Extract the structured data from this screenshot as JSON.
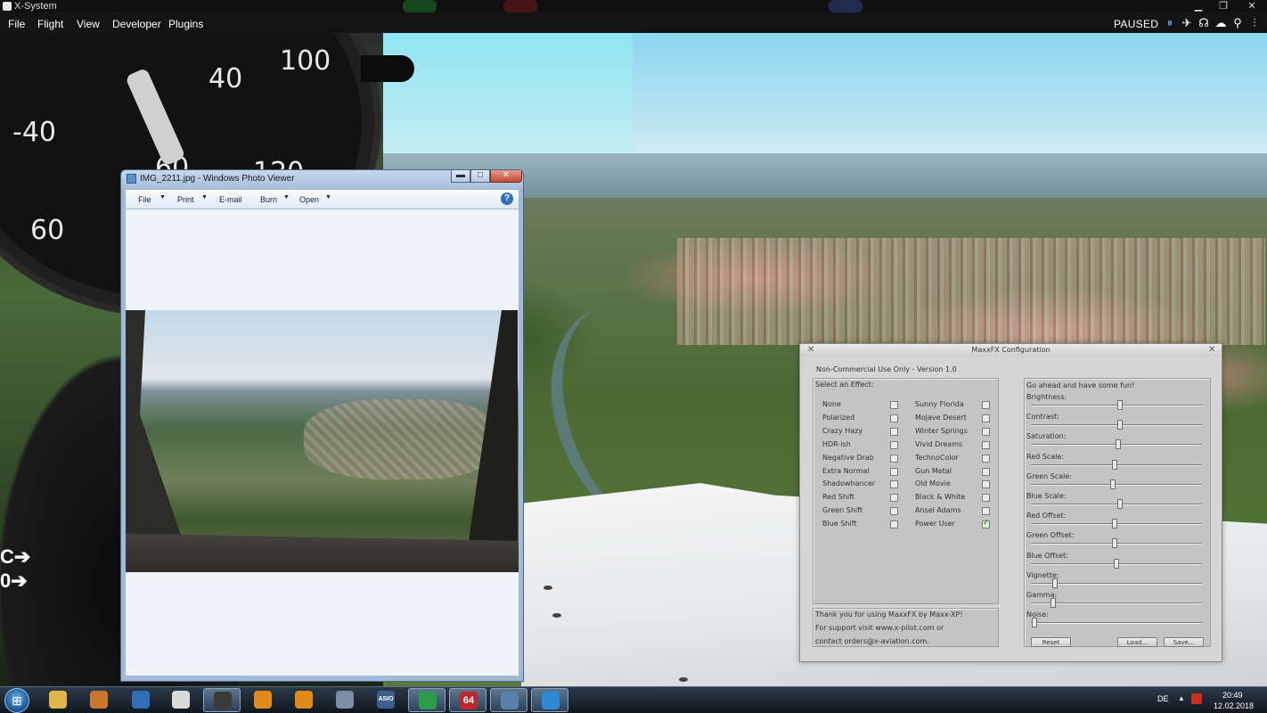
{
  "xsystem": {
    "title": "X-System",
    "menu": [
      "File",
      "Flight",
      "View",
      "Developer",
      "Plugins"
    ],
    "status": "PAUSED",
    "toolbar_icons": [
      "pause-icon",
      "airplane-icon",
      "headset-icon",
      "weather-icon",
      "map-pin-icon",
      "sliders-icon",
      "help-icon"
    ]
  },
  "cockpit_gauge": {
    "numbers": [
      "-40",
      "40",
      "100",
      "60",
      "120",
      "60"
    ]
  },
  "photo_viewer": {
    "title": "IMG_2211.jpg - Windows Photo Viewer",
    "toolbar": [
      "File",
      "Print",
      "E-mail",
      "Burn",
      "Open"
    ],
    "minimize": "▬",
    "maximize": "□",
    "close": "✕",
    "help": "?"
  },
  "maxxfx": {
    "title": "MaxxFX Configuration",
    "subtitle": "Non-Commercial Use Only - Version 1.0",
    "effects_header": "Select an Effect:",
    "effects_col1": [
      "None",
      "Polarized",
      "Crazy Hazy",
      "HDR-ish",
      "Negative Drab",
      "Extra Normal",
      "Shadowhancer",
      "Red Shift",
      "Green Shift",
      "Blue Shift"
    ],
    "effects_col2": [
      "Sunny Florida",
      "Mojave Desert",
      "Winter Springs",
      "Vivid Dreams",
      "TechnoColor",
      "Gun Metal",
      "Old Movie",
      "Black & White",
      "Ansel Adams",
      "Power User"
    ],
    "selected_effect": "Power User",
    "footer_lines": [
      "Thank you for using MaxxFX by Maxx-XP!",
      "For support visit www.x-pilot.com or",
      "contact orders@x-aviation.com."
    ],
    "sliders_header": "Go ahead and have some fun!",
    "sliders": [
      {
        "label": "Brightness:",
        "value": 0.52
      },
      {
        "label": "Contrast:",
        "value": 0.52
      },
      {
        "label": "Saturation:",
        "value": 0.51
      },
      {
        "label": "Red Scale:",
        "value": 0.49
      },
      {
        "label": "Green Scale:",
        "value": 0.48
      },
      {
        "label": "Blue Scale:",
        "value": 0.52
      },
      {
        "label": "Red Offset:",
        "value": 0.49
      },
      {
        "label": "Green Offset:",
        "value": 0.49
      },
      {
        "label": "Blue Offset:",
        "value": 0.5
      },
      {
        "label": "Vignette:",
        "value": 0.14
      },
      {
        "label": "Gamma:",
        "value": 0.13
      },
      {
        "label": "Noise:",
        "value": 0.02
      }
    ],
    "buttons": {
      "reset": "Reset",
      "load": "Load...",
      "save": "Save..."
    }
  },
  "taskbar": {
    "start_icon": "windows-start-icon",
    "apps": [
      "folder-icon",
      "media-player-icon",
      "network-globe-icon",
      "calculator-icon",
      "x-system-app-icon",
      "radar-icon-1",
      "radar-icon-2",
      "controller-icon",
      "asio-icon",
      "chrome-icon",
      "sixty-four-icon",
      "photo-viewer-icon",
      "x-plane-icon"
    ],
    "app_badge_text": "64",
    "asio_text": "ASIO",
    "language": "DE",
    "tray_arrow": "▲",
    "time": "20:49",
    "date": "12.02.2018"
  }
}
